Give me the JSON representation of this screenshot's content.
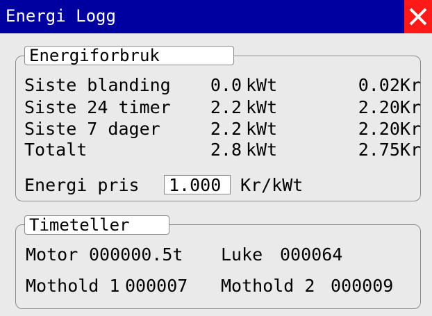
{
  "window": {
    "title": "Energi Logg",
    "close_icon": "close-x-icon",
    "title_bg": "#0000a0",
    "close_bg": "#ff1a1a"
  },
  "energy": {
    "group_title": "Energiforbruk",
    "rows": [
      {
        "label": "Siste blanding",
        "kwh": "0.0",
        "kwh_unit": "kWt",
        "cost": "0.02Kr"
      },
      {
        "label": "Siste 24 timer",
        "kwh": "2.2",
        "kwh_unit": "kWt",
        "cost": "2.20Kr"
      },
      {
        "label": "Siste 7 dager",
        "kwh": "2.2",
        "kwh_unit": "kWt",
        "cost": "2.20Kr"
      },
      {
        "label": "Totalt",
        "kwh": "2.8",
        "kwh_unit": "kWt",
        "cost": "2.75Kr"
      }
    ],
    "price_label": "Energi pris",
    "price_value": "1.000",
    "price_unit": "Kr/kWt"
  },
  "hours": {
    "group_title": "Timeteller",
    "motor_label": "Motor",
    "motor_value": "000000.5t",
    "luke_label": "Luke",
    "luke_value": "000064",
    "mothold1_label": "Mothold 1",
    "mothold1_value": "000007",
    "mothold2_label": "Mothold 2",
    "mothold2_value": "000009"
  }
}
